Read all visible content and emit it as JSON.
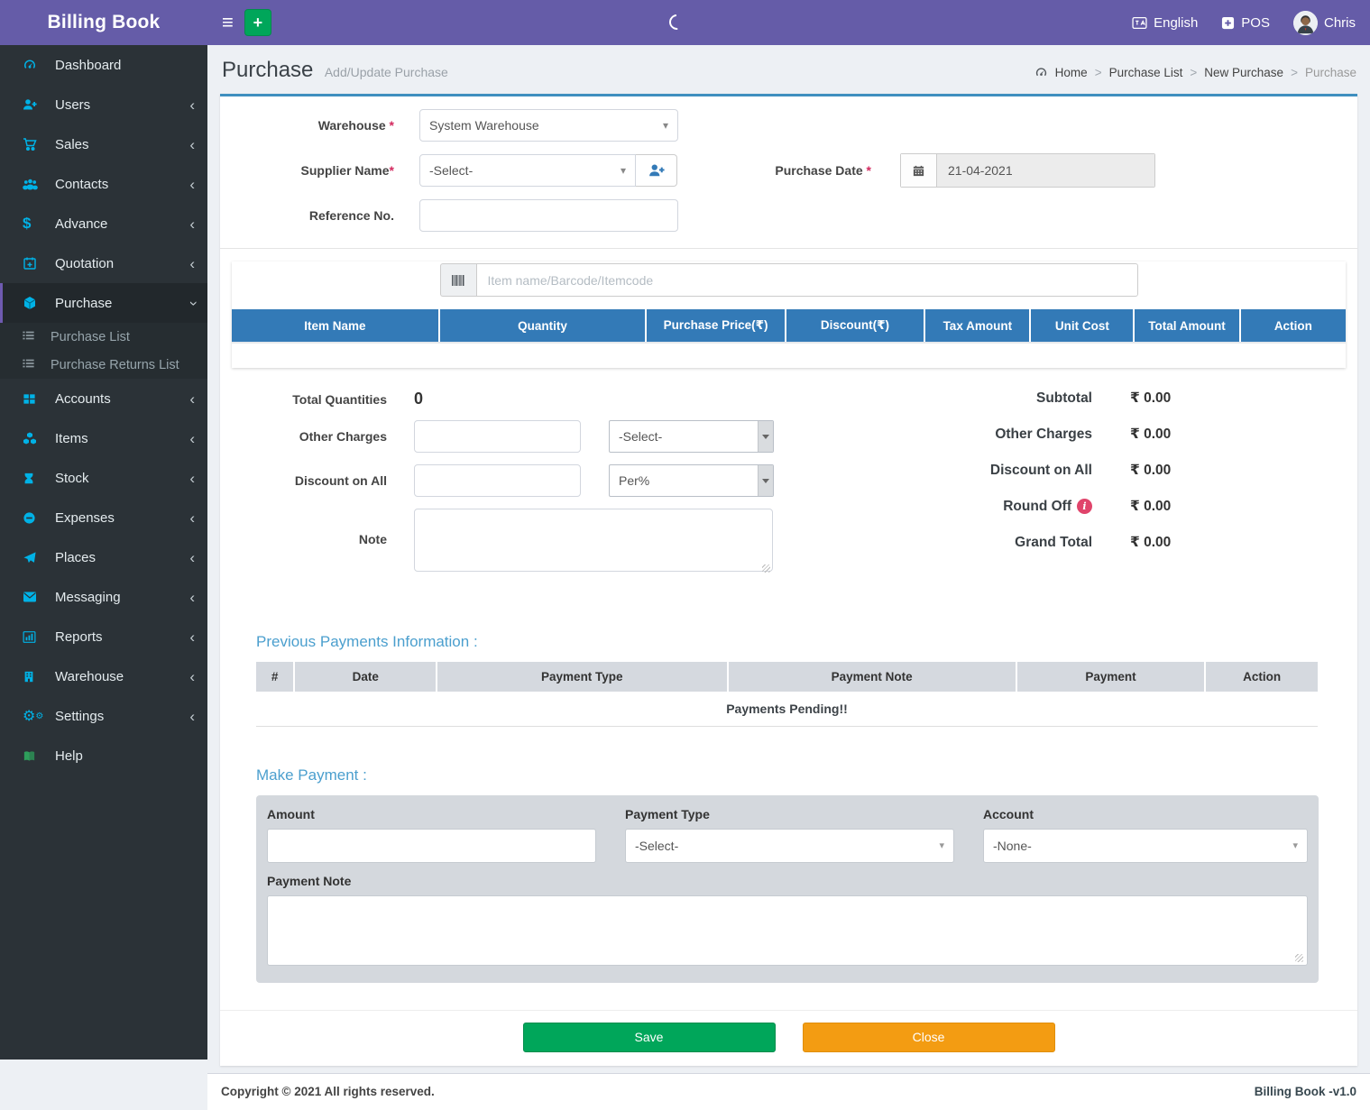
{
  "app": {
    "name": "Billing Book",
    "version": "Billing Book -v1.0",
    "copyright": "Copyright © 2021 All rights reserved."
  },
  "topbar": {
    "language": "English",
    "pos_label": "POS",
    "username": "Chris"
  },
  "sidebar": {
    "items": [
      {
        "label": "Dashboard"
      },
      {
        "label": "Users"
      },
      {
        "label": "Sales"
      },
      {
        "label": "Contacts"
      },
      {
        "label": "Advance"
      },
      {
        "label": "Quotation"
      },
      {
        "label": "Purchase"
      },
      {
        "label": "Accounts"
      },
      {
        "label": "Items"
      },
      {
        "label": "Stock"
      },
      {
        "label": "Expenses"
      },
      {
        "label": "Places"
      },
      {
        "label": "Messaging"
      },
      {
        "label": "Reports"
      },
      {
        "label": "Warehouse"
      },
      {
        "label": "Settings"
      },
      {
        "label": "Help"
      }
    ],
    "purchase_submenu": [
      {
        "label": "Purchase List"
      },
      {
        "label": "Purchase Returns List"
      }
    ]
  },
  "page": {
    "title": "Purchase",
    "subtitle": "Add/Update Purchase",
    "breadcrumb": [
      "Home",
      "Purchase List",
      "New Purchase",
      "Purchase"
    ]
  },
  "form": {
    "warehouse_label": "Warehouse",
    "warehouse_value": "System Warehouse",
    "supplier_label": "Supplier Name",
    "supplier_value": "-Select-",
    "reference_label": "Reference No.",
    "purchase_date_label": "Purchase Date",
    "purchase_date_value": "21-04-2021",
    "item_search_placeholder": "Item name/Barcode/Itemcode",
    "required_marker": "*"
  },
  "items_table": {
    "headers": [
      "Item Name",
      "Quantity",
      "Purchase Price(₹)",
      "Discount(₹)",
      "Tax Amount",
      "Unit Cost",
      "Total Amount",
      "Action"
    ]
  },
  "totals_left": {
    "total_quantities_label": "Total Quantities",
    "total_quantities_value": "0",
    "other_charges_label": "Other Charges",
    "other_charges_type": "-Select-",
    "discount_label": "Discount on All",
    "discount_type": "Per%",
    "note_label": "Note"
  },
  "totals_right": {
    "rows": [
      {
        "label": "Subtotal",
        "value": "₹ 0.00"
      },
      {
        "label": "Other Charges",
        "value": "₹ 0.00"
      },
      {
        "label": "Discount on All",
        "value": "₹ 0.00"
      },
      {
        "label": "Round Off",
        "value": "₹ 0.00"
      },
      {
        "label": "Grand Total",
        "value": "₹ 0.00"
      }
    ],
    "info_glyph": "i"
  },
  "payments": {
    "heading": "Previous Payments Information :",
    "headers": [
      "#",
      "Date",
      "Payment Type",
      "Payment Note",
      "Payment",
      "Action"
    ],
    "empty_message": "Payments Pending!!"
  },
  "make_payment": {
    "heading": "Make Payment :",
    "amount_label": "Amount",
    "payment_type_label": "Payment Type",
    "payment_type_value": "-Select-",
    "account_label": "Account",
    "account_value": "-None-",
    "note_label": "Payment Note"
  },
  "actions": {
    "save_label": "Save",
    "close_label": "Close"
  },
  "colors": {
    "topbar": "#655ca8",
    "sidebar": "#2b3237",
    "sidebar_icon": "#00b2e6",
    "table_header": "#337ab7",
    "heading_blue": "#4b9fce",
    "save": "#00a65a",
    "close": "#f39c12",
    "required": "#d32a5f"
  }
}
